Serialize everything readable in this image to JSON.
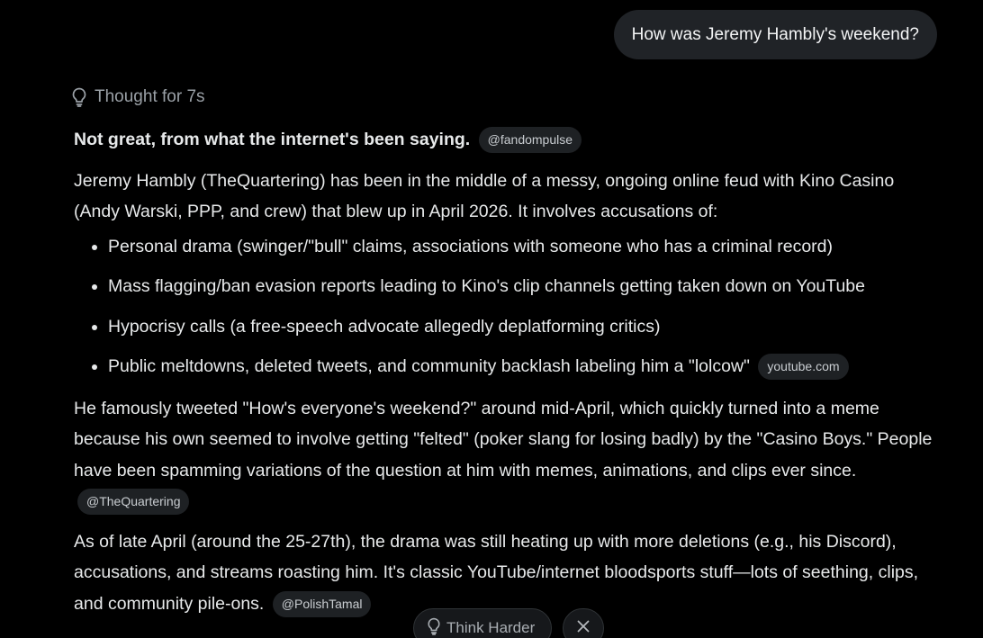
{
  "user_message": "How was Jeremy Hambly's weekend?",
  "thought_label": "Thought for 7s",
  "answer": {
    "lead": "Not great, from what the internet's been saying.",
    "lead_source": "@fandompulse",
    "intro": "Jeremy Hambly (TheQuartering) has been in the middle of a messy, ongoing online feud with Kino Casino (Andy Warski, PPP, and crew) that blew up in April 2026. It involves accusations of:",
    "bullets": [
      "Personal drama (swinger/\"bull\" claims, associations with someone who has a criminal record)",
      "Mass flagging/ban evasion reports leading to Kino's clip channels getting taken down on YouTube",
      "Hypocrisy calls (a free-speech advocate allegedly deplatforming critics)",
      "Public meltdowns, deleted tweets, and community backlash labeling him a \"lolcow\""
    ],
    "bullets_source": "youtube.com",
    "para2": "He famously tweeted \"How's everyone's weekend?\" around mid-April, which quickly turned into a meme because his own seemed to involve getting \"felted\" (poker slang for losing badly) by the \"Casino Boys.\" People have been spamming variations of the question at him with memes, animations, and clips ever since.",
    "para2_source": "@TheQuartering",
    "para3": "As of late April (around the 25-27th), the drama was still heating up with more deletions (e.g., his Discord), accusations, and streams roasting him. It's classic YouTube/internet bloodsports stuff—lots of seething, clips, and community pile-ons.",
    "para3_source": "@PolishTamal"
  },
  "actions": {
    "think_harder_label": "Think Harder"
  },
  "colors": {
    "background": "#000000",
    "bubble": "#202327",
    "chip": "#1e2124",
    "text": "#e7e9ea",
    "muted": "#9aa0a6"
  },
  "icons": {
    "thought": "lightbulb-icon",
    "think_harder": "lightbulb-icon",
    "close": "close-icon"
  }
}
